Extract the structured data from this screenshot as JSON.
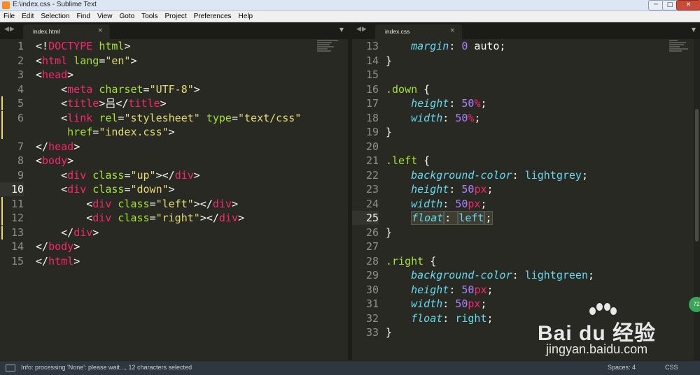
{
  "window": {
    "title": "E:\\index.css - Sublime Text",
    "controls": [
      "─",
      "□",
      "✕"
    ]
  },
  "menu": [
    "File",
    "Edit",
    "Selection",
    "Find",
    "View",
    "Goto",
    "Tools",
    "Project",
    "Preferences",
    "Help"
  ],
  "left_pane": {
    "tab": "index.html",
    "lines": [
      {
        "n": "1",
        "tokens": [
          [
            "p",
            "<!"
          ],
          [
            "t",
            "DOCTYPE "
          ],
          [
            "a",
            "html"
          ],
          [
            "p",
            ">"
          ]
        ]
      },
      {
        "n": "2",
        "tokens": [
          [
            "p",
            "<"
          ],
          [
            "t",
            "html "
          ],
          [
            "a",
            "lang"
          ],
          [
            "p",
            "="
          ],
          [
            "s",
            "\"en\""
          ],
          [
            "p",
            ">"
          ]
        ]
      },
      {
        "n": "3",
        "tokens": [
          [
            "p",
            "<"
          ],
          [
            "t",
            "head"
          ],
          [
            "p",
            ">"
          ]
        ]
      },
      {
        "n": "4",
        "tokens": [
          [
            "p",
            "    <"
          ],
          [
            "t",
            "meta "
          ],
          [
            "a",
            "charset"
          ],
          [
            "p",
            "="
          ],
          [
            "s",
            "\"UTF-8\""
          ],
          [
            "p",
            ">"
          ]
        ]
      },
      {
        "n": "5",
        "tokens": [
          [
            "p",
            "    <"
          ],
          [
            "t",
            "title"
          ],
          [
            "p",
            ">吕</"
          ],
          [
            "t",
            "title"
          ],
          [
            "p",
            ">"
          ]
        ]
      },
      {
        "n": "6",
        "tokens": [
          [
            "p",
            "    <"
          ],
          [
            "t",
            "link "
          ],
          [
            "a",
            "rel"
          ],
          [
            "p",
            "="
          ],
          [
            "s",
            "\"stylesheet\" "
          ],
          [
            "a",
            "type"
          ],
          [
            "p",
            "="
          ],
          [
            "s",
            "\"text/css\""
          ]
        ]
      },
      {
        "n": "",
        "tokens": [
          [
            "p",
            "     "
          ],
          [
            "a",
            "href"
          ],
          [
            "p",
            "="
          ],
          [
            "s",
            "\"index.css\""
          ],
          [
            "p",
            ">"
          ]
        ]
      },
      {
        "n": "7",
        "tokens": [
          [
            "p",
            "</"
          ],
          [
            "t",
            "head"
          ],
          [
            "p",
            ">"
          ]
        ]
      },
      {
        "n": "8",
        "tokens": [
          [
            "p",
            "<"
          ],
          [
            "t",
            "body"
          ],
          [
            "p",
            ">"
          ]
        ]
      },
      {
        "n": "9",
        "tokens": [
          [
            "p",
            "    <"
          ],
          [
            "t",
            "div "
          ],
          [
            "a",
            "class"
          ],
          [
            "p",
            "="
          ],
          [
            "s",
            "\"up\""
          ],
          [
            "p",
            "></"
          ],
          [
            "t",
            "div"
          ],
          [
            "p",
            ">"
          ]
        ]
      },
      {
        "n": "10",
        "tokens": [
          [
            "p",
            "    <"
          ],
          [
            "t",
            "div "
          ],
          [
            "a",
            "class"
          ],
          [
            "p",
            "="
          ],
          [
            "s",
            "\"down\""
          ],
          [
            "p",
            ">"
          ]
        ],
        "current": true
      },
      {
        "n": "11",
        "tokens": [
          [
            "p",
            "        <"
          ],
          [
            "t",
            "div "
          ],
          [
            "a",
            "class"
          ],
          [
            "p",
            "="
          ],
          [
            "s",
            "\"left\""
          ],
          [
            "p",
            "></"
          ],
          [
            "t",
            "div"
          ],
          [
            "p",
            ">"
          ]
        ]
      },
      {
        "n": "12",
        "tokens": [
          [
            "p",
            "        <"
          ],
          [
            "t",
            "div "
          ],
          [
            "a",
            "class"
          ],
          [
            "p",
            "="
          ],
          [
            "s",
            "\"right\""
          ],
          [
            "p",
            "></"
          ],
          [
            "t",
            "div"
          ],
          [
            "p",
            ">"
          ]
        ]
      },
      {
        "n": "13",
        "tokens": [
          [
            "p",
            "    </"
          ],
          [
            "t",
            "div"
          ],
          [
            "p",
            ">"
          ]
        ]
      },
      {
        "n": "14",
        "tokens": [
          [
            "p",
            "</"
          ],
          [
            "t",
            "body"
          ],
          [
            "p",
            ">"
          ]
        ]
      },
      {
        "n": "15",
        "tokens": [
          [
            "p",
            "</"
          ],
          [
            "t",
            "html"
          ],
          [
            "p",
            ">"
          ]
        ]
      }
    ]
  },
  "right_pane": {
    "tab": "index.css",
    "lines": [
      {
        "n": "13",
        "tokens": [
          [
            "p",
            "    "
          ],
          [
            "k",
            "margin"
          ],
          [
            "p",
            ": "
          ],
          [
            "n",
            "0"
          ],
          [
            "p",
            " auto;"
          ]
        ]
      },
      {
        "n": "14",
        "tokens": [
          [
            "p",
            "}"
          ]
        ]
      },
      {
        "n": "15",
        "tokens": []
      },
      {
        "n": "16",
        "tokens": [
          [
            "c",
            ".down"
          ],
          [
            "p",
            " {"
          ]
        ]
      },
      {
        "n": "17",
        "tokens": [
          [
            "p",
            "    "
          ],
          [
            "k",
            "height"
          ],
          [
            "p",
            ": "
          ],
          [
            "n",
            "50"
          ],
          [
            "t",
            "%"
          ],
          [
            "p",
            ";"
          ]
        ]
      },
      {
        "n": "18",
        "tokens": [
          [
            "p",
            "    "
          ],
          [
            "k",
            "width"
          ],
          [
            "p",
            ": "
          ],
          [
            "n",
            "50"
          ],
          [
            "t",
            "%"
          ],
          [
            "p",
            ";"
          ]
        ]
      },
      {
        "n": "19",
        "tokens": [
          [
            "p",
            "}"
          ]
        ]
      },
      {
        "n": "20",
        "tokens": []
      },
      {
        "n": "21",
        "tokens": [
          [
            "c",
            ".left"
          ],
          [
            "p",
            " {"
          ]
        ]
      },
      {
        "n": "22",
        "tokens": [
          [
            "p",
            "    "
          ],
          [
            "k",
            "background-color"
          ],
          [
            "p",
            ": "
          ],
          [
            "v",
            "lightgrey"
          ],
          [
            "p",
            ";"
          ]
        ]
      },
      {
        "n": "23",
        "tokens": [
          [
            "p",
            "    "
          ],
          [
            "k",
            "height"
          ],
          [
            "p",
            ": "
          ],
          [
            "n",
            "50"
          ],
          [
            "t",
            "px"
          ],
          [
            "p",
            ";"
          ]
        ]
      },
      {
        "n": "24",
        "tokens": [
          [
            "p",
            "    "
          ],
          [
            "k",
            "width"
          ],
          [
            "p",
            ": "
          ],
          [
            "n",
            "50"
          ],
          [
            "t",
            "px"
          ],
          [
            "p",
            ";"
          ]
        ]
      },
      {
        "n": "25",
        "tokens": [
          [
            "p",
            "    "
          ],
          [
            "k",
            "float"
          ],
          [
            "p",
            ": "
          ],
          [
            "v",
            "left"
          ],
          [
            "p",
            ";"
          ]
        ],
        "current": true
      },
      {
        "n": "26",
        "tokens": [
          [
            "p",
            "}"
          ]
        ]
      },
      {
        "n": "27",
        "tokens": []
      },
      {
        "n": "28",
        "tokens": [
          [
            "c",
            ".right"
          ],
          [
            "p",
            " {"
          ]
        ]
      },
      {
        "n": "29",
        "tokens": [
          [
            "p",
            "    "
          ],
          [
            "k",
            "background-color"
          ],
          [
            "p",
            ": "
          ],
          [
            "v",
            "lightgreen"
          ],
          [
            "p",
            ";"
          ]
        ]
      },
      {
        "n": "30",
        "tokens": [
          [
            "p",
            "    "
          ],
          [
            "k",
            "height"
          ],
          [
            "p",
            ": "
          ],
          [
            "n",
            "50"
          ],
          [
            "t",
            "px"
          ],
          [
            "p",
            ";"
          ]
        ]
      },
      {
        "n": "31",
        "tokens": [
          [
            "p",
            "    "
          ],
          [
            "k",
            "width"
          ],
          [
            "p",
            ": "
          ],
          [
            "n",
            "50"
          ],
          [
            "t",
            "px"
          ],
          [
            "p",
            ";"
          ]
        ]
      },
      {
        "n": "32",
        "tokens": [
          [
            "p",
            "    "
          ],
          [
            "k",
            "float"
          ],
          [
            "p",
            ": "
          ],
          [
            "v",
            "right"
          ],
          [
            "p",
            ";"
          ]
        ]
      },
      {
        "n": "33",
        "tokens": [
          [
            "p",
            "}"
          ]
        ]
      }
    ]
  },
  "statusbar": {
    "message": "Info: processing 'None': please wait..., 12 characters selected",
    "spaces": "Spaces: 4",
    "syntax": "CSS"
  },
  "overlay": {
    "badge": "72",
    "watermark_brand": "Bai du 经验",
    "watermark_sub": "jingyan.baidu.com"
  },
  "theme": {
    "background": "#282923",
    "tag": "#f92672",
    "attr": "#a6e22e",
    "string": "#e6db74",
    "number": "#ae81ff",
    "property": "#66d9ef"
  }
}
